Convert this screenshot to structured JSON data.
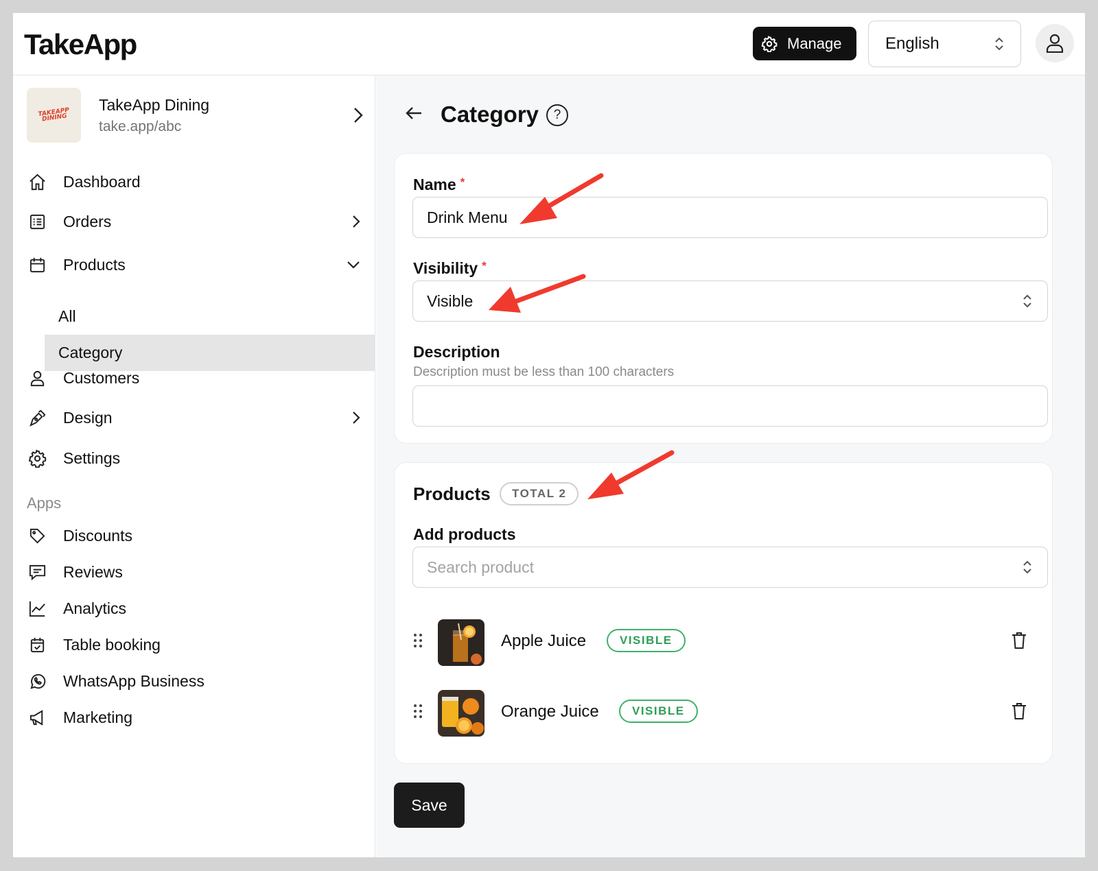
{
  "header": {
    "logo": "TakeApp",
    "manage_label": "Manage",
    "language": "English"
  },
  "store": {
    "name": "TakeApp Dining",
    "url": "take.app/abc",
    "logo_text_top": "TAKEAPP",
    "logo_text_bottom": "DINING"
  },
  "sidebar": {
    "items": [
      {
        "label": "Dashboard",
        "icon": "home-icon"
      },
      {
        "label": "Orders",
        "icon": "orders-icon"
      },
      {
        "label": "Products",
        "icon": "products-icon"
      },
      {
        "label": "Customers",
        "icon": "user-icon"
      },
      {
        "label": "Design",
        "icon": "pen-icon"
      },
      {
        "label": "Settings",
        "icon": "gear-icon"
      }
    ],
    "product_sub": [
      {
        "label": "All"
      },
      {
        "label": "Category",
        "active": true
      }
    ],
    "apps_heading": "Apps",
    "apps": [
      {
        "label": "Discounts",
        "icon": "tag-icon"
      },
      {
        "label": "Reviews",
        "icon": "chat-icon"
      },
      {
        "label": "Analytics",
        "icon": "chart-icon"
      },
      {
        "label": "Table booking",
        "icon": "calendar-icon"
      },
      {
        "label": "WhatsApp Business",
        "icon": "whatsapp-icon"
      },
      {
        "label": "Marketing",
        "icon": "megaphone-icon"
      }
    ]
  },
  "main": {
    "title": "Category",
    "help": "?",
    "form": {
      "name_label": "Name",
      "name_value": "Drink Menu",
      "required_mark": "*",
      "visibility_label": "Visibility",
      "visibility_value": "Visible",
      "description_label": "Description",
      "description_hint": "Description must be less than 100 characters",
      "description_value": ""
    },
    "products": {
      "title": "Products",
      "total_badge": "TOTAL 2",
      "add_label": "Add products",
      "search_placeholder": "Search product",
      "items": [
        {
          "name": "Apple Juice",
          "status": "VISIBLE"
        },
        {
          "name": "Orange Juice",
          "status": "VISIBLE"
        }
      ]
    },
    "save_label": "Save"
  },
  "colors": {
    "accent_dark": "#111111",
    "required": "#e53935",
    "visible_badge": "#2f9e57",
    "annotation_arrow": "#f03a2e"
  }
}
